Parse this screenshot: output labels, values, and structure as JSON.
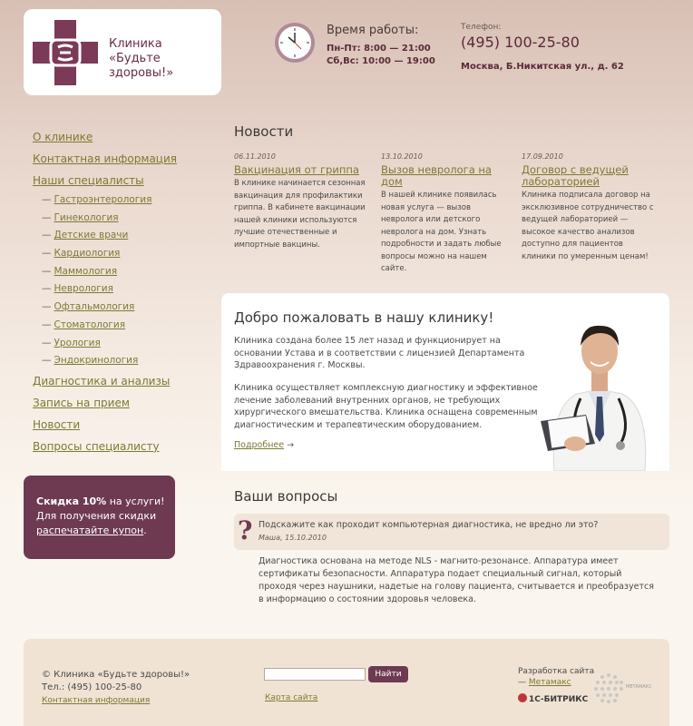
{
  "header": {
    "clinic_name_line1": "Клиника",
    "clinic_name_line2": "«Будьте здоровы!»",
    "hours_title": "Время работы:",
    "hours_weekdays": "Пн-Пт: 8:00 — 21:00",
    "hours_weekend": "Сб,Вс: 10:00 — 19:00",
    "phone_label": "Телефон:",
    "phone": "(495) 100-25-80",
    "address": "Москва, Б.Никитская ул., д. 62"
  },
  "sidebar": {
    "items": [
      {
        "label": "О клинике"
      },
      {
        "label": "Контактная информация"
      },
      {
        "label": "Наши специалисты"
      }
    ],
    "sub_items": [
      {
        "label": "Гастроэнтерология"
      },
      {
        "label": "Гинекология"
      },
      {
        "label": "Детские врачи"
      },
      {
        "label": "Кардиология"
      },
      {
        "label": "Маммология"
      },
      {
        "label": "Неврология"
      },
      {
        "label": "Офтальмология"
      },
      {
        "label": "Стоматология"
      },
      {
        "label": "Урология"
      },
      {
        "label": "Эндокринология"
      }
    ],
    "items_after": [
      {
        "label": "Диагностика и анализы"
      },
      {
        "label": "Запись на прием"
      },
      {
        "label": "Новости"
      },
      {
        "label": "Вопросы специалисту"
      }
    ],
    "sub_dash": "—"
  },
  "promo": {
    "bold": "Скидка 10%",
    "text1": "на услуги!",
    "text2": "Для получения скидки",
    "link": "распечатайте купон",
    "tail": "."
  },
  "news": {
    "title": "Новости",
    "items": [
      {
        "date": "06.11.2010",
        "headline": "Вакцинация от гриппа",
        "text": "В клинике начинается сезонная вакцинация для профилактики гриппа. В кабинете вакцинации нашей клиники используются лучшие отечественные и импортные вакцины."
      },
      {
        "date": "13.10.2010",
        "headline": "Вызов невролога на дом",
        "text": "В нашей клинике появилась новая услуга — вызов невролога или детского невролога на дом. Узнать подробности и задать любые вопросы можно на нашем сайте."
      },
      {
        "date": "17.09.2010",
        "headline": "Договор с ведущей лабораторией",
        "text": "Клиника подписала договор на эксклюзивное сотрудничество с ведущей лабораторией — высокое качество анализов доступно для пациентов клиники по умеренным ценам!"
      }
    ]
  },
  "welcome": {
    "title": "Добро пожаловать в нашу клинику!",
    "p1": "Клиника создана более 15 лет назад и функционирует на основании Устава и в соответствии с лицензией Департамента Здравоохранения г. Москвы.",
    "p2": "Клиника осуществляет комплексную диагностику и эффективное лечение заболеваний внутренних органов, не требующих хирургического вмешательства. Клиника оснащена современным диагностическим и терапевтическим оборудованием.",
    "more": "Подробнее",
    "more_arrow": "→"
  },
  "questions": {
    "title": "Ваши вопросы",
    "mark": "?",
    "question": "Подскажите как проходит компьютерная диагностика, не вредно ли это?",
    "author": "Маша, 15.10.2010",
    "answer": "Диагностика основана на методе NLS - магнито-резонансе. Аппаратура имеет сертификаты безопасности. Аппаратура подает специальный сигнал, который проходя через наушники, надетые на голову пациента, считывается и преобразуется в информацию о состоянии здоровья человека."
  },
  "footer": {
    "copyright": "© Клиника «Будьте здоровы!»",
    "phone": "Тел.: (495) 100-25-80",
    "contacts": "Контактная информация",
    "search_value": "",
    "search_button": "Найти",
    "sitemap": "Карта сайта",
    "dev_label": "Разработка сайта",
    "dev_dash": "—",
    "dev_link": "Метамакс",
    "bitrix": "1С-БИТРИКС",
    "metamax_label": "МЕТАМАКС"
  },
  "colors": {
    "brand": "#6e3a52",
    "link": "#7d7a32",
    "bg_top": "#d8bfb4",
    "bg_bottom": "#faf5ee"
  }
}
